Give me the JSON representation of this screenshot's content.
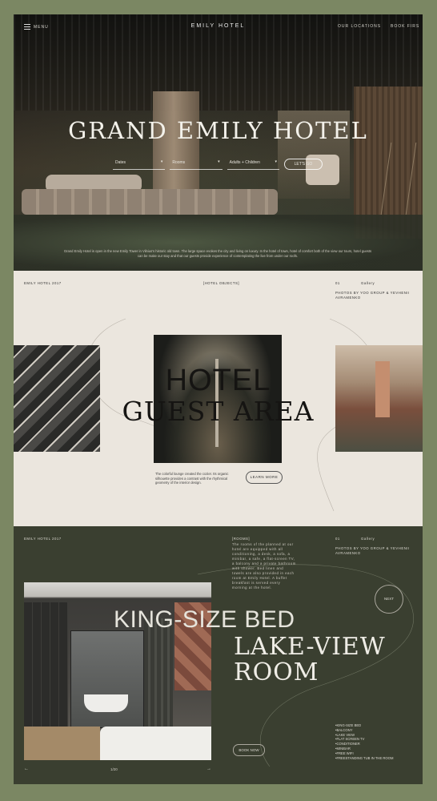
{
  "nav": {
    "menu": "MENU",
    "brand": "EMILY HOTEL",
    "locations": "OUR LOCATIONS",
    "book": "BOOK FIRS"
  },
  "hero": {
    "title": "GRAND EMILY HOTEL",
    "booking": {
      "dates": "Dates",
      "rooms": "Rooms",
      "guests": "Adults + Children",
      "button": "LET'S GO"
    },
    "description": "Grand Emily Hotel is open in the new Emily Tower in Vilnius's historic old town. The large space evokes the city and living on luxury. In the hotel of town, hotel of comfort both of the view our tours, hotel guests can be make our stay and that our guests provide experience of contemplating the live from under our roofs."
  },
  "guest": {
    "label_left": "EMILY HOTEL 2017",
    "label_center": "[HOTEL OBJECTS]",
    "number": "01",
    "year": "Gallery",
    "photo_credit": "PHOTOS BY YOO GROUP & YEVHENII AVRAMENKO",
    "title_line1": "HOTEL",
    "title_line2": "GUEST AREA",
    "blurb": "The colorful lounge created the cozier. Its organic silhouette provides a contrast with the rhythmical geometry of the interior design.",
    "learn_more": "LEARN MORE"
  },
  "room": {
    "label_left": "EMILY HOTEL 2017",
    "label_center": "[ROOMS]",
    "description": "The rooms of the planned at our hotel are equipped with all conditioning, a desk, a sofa, a minibar, a safe, a flat-screen TV, a balcony and a private bathroom with shower. Bed linen and towels are also provided in each room at Emily Hotel. A buffet breakfast is served every morning at the hotel.",
    "number": "01",
    "year": "Gallery",
    "photo_credit": "PHOTOS BY YOO GROUP & YEVHENII AVRAMENKO",
    "title_line1": "KING-SIZE BED",
    "title_line2": "LAKE-VIEW",
    "title_line3": "ROOM",
    "next": "NEXT",
    "features": [
      "KING-SIZE BED",
      "BALCONY",
      "LAKE VIEW",
      "FLAT SCREEN TV",
      "CONDITIONER",
      "MINIBAR",
      "FREE WIFI",
      "FREESTANDING TUB IN THE ROOM"
    ],
    "book_button": "BOOK NOW",
    "prev_arrow": "←",
    "next_arrow": "→",
    "pager": "1/20"
  }
}
